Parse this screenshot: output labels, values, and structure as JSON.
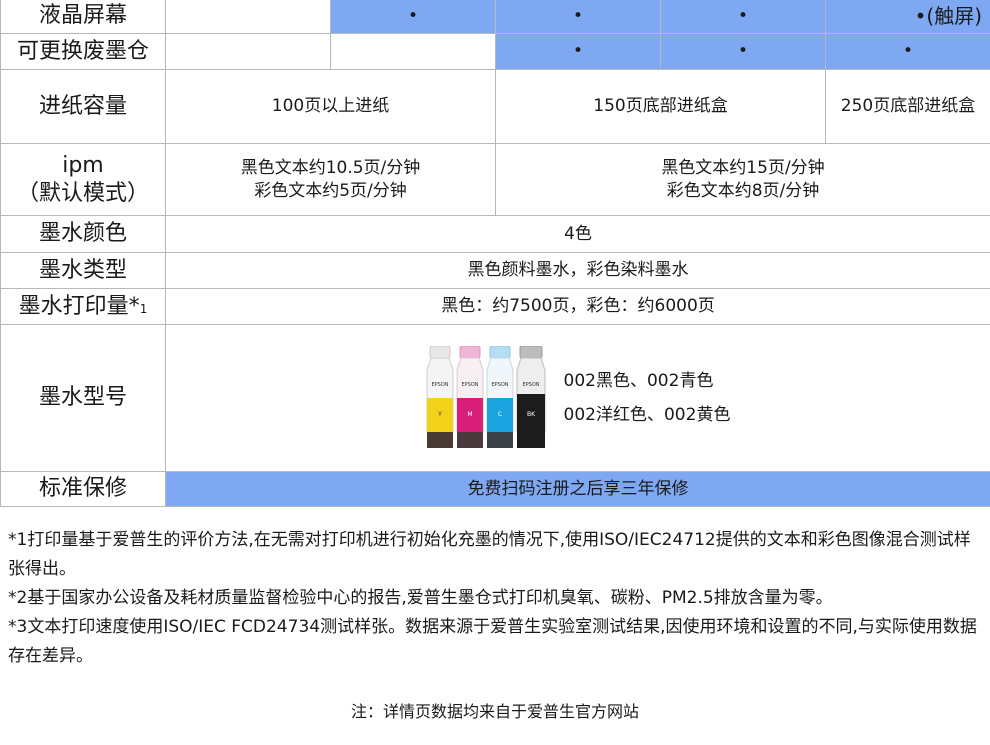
{
  "colors": {
    "accent_blue": "#7ea9f2",
    "border": "#b8b8b8",
    "text": "#1a1a1a"
  },
  "rows": {
    "lcd": {
      "label": "液晶屏幕",
      "dot": "•",
      "touch": "•(触屏)"
    },
    "tank": {
      "label": "可更换废墨仓",
      "dot": "•"
    },
    "paper": {
      "label": "进纸容量",
      "a": "100页以上进纸",
      "b": "150页底部进纸盒",
      "c": "250页底部进纸盒"
    },
    "ipm": {
      "label_line1": "ipm",
      "label_line2": "（默认模式）",
      "a_line1": "黑色文本约10.5页/分钟",
      "a_line2": "彩色文本约5页/分钟",
      "b_line1": "黑色文本约15页/分钟",
      "b_line2": "彩色文本约8页/分钟"
    },
    "ink_color": {
      "label": "墨水颜色",
      "value": "4色"
    },
    "ink_type": {
      "label": "墨水类型",
      "value": "黑色颜料墨水，彩色染料墨水"
    },
    "ink_yield": {
      "label": "墨水打印量*",
      "sup": "1",
      "value": "黑色：约7500页，彩色：约6000页"
    },
    "ink_model": {
      "label": "墨水型号",
      "line1": "002黑色、002青色",
      "line2": "002洋红色、002黄色",
      "bottle_brand": "EPSON",
      "bottles": [
        {
          "color": "yellow",
          "mark": "Y"
        },
        {
          "color": "magenta",
          "mark": "M"
        },
        {
          "color": "cyan",
          "mark": "C"
        },
        {
          "color": "black",
          "mark": "BK"
        }
      ]
    },
    "warranty": {
      "label": "标准保修",
      "value": "免费扫码注册之后享三年保修"
    }
  },
  "footnotes": {
    "n1": "*1打印量基于爱普生的评价方法,在无需对打印机进行初始化充墨的情况下,使用ISO/IEC24712提供的文本和彩色图像混合测试样张得出。",
    "n2": "*2基于国家办公设备及耗材质量监督检验中心的报告,爱普生墨仓式打印机臭氧、碳粉、PM2.5排放含量为零。",
    "n3": "*3文本打印速度使用ISO/IEC FCD24734测试样张。数据来源于爱普生实验室测试结果,因使用环境和设置的不同,与实际使用数据存在差异。"
  },
  "source_note": "注：详情页数据均来自于爱普生官方网站"
}
